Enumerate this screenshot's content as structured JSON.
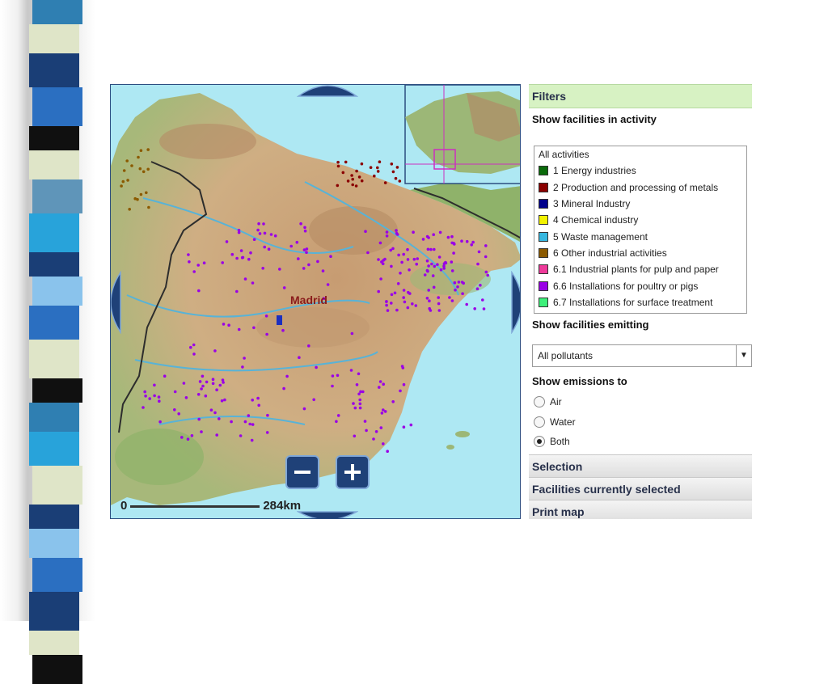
{
  "map": {
    "city_label": "Madrid",
    "scale_start": "0",
    "scale_end": "284km",
    "zoom_out_label": "−",
    "zoom_in_label": "+",
    "colors": {
      "sea": "#aee8f3",
      "land": "#cfa77c",
      "points": "#9a2be2"
    }
  },
  "filters": {
    "header": "Filters",
    "activity_heading": "Show facilities in activity",
    "activities": [
      {
        "label": "All activities",
        "color": ""
      },
      {
        "label": "1 Energy industries",
        "color": "#0a6a0a"
      },
      {
        "label": "2 Production and processing of metals",
        "color": "#8b0000"
      },
      {
        "label": "3 Mineral Industry",
        "color": "#00008b"
      },
      {
        "label": "4 Chemical industry",
        "color": "#f2f200"
      },
      {
        "label": "5 Waste management",
        "color": "#36b7e0"
      },
      {
        "label": "6 Other industrial activities",
        "color": "#8b5a00"
      },
      {
        "label": "6.1  Industrial plants for pulp and paper",
        "color": "#ee3a9a"
      },
      {
        "label": "6.6  Installations for poultry or pigs",
        "color": "#9a00e6"
      },
      {
        "label": "6.7  Installations for surface treatment",
        "color": "#3ef07a"
      }
    ],
    "emitting_heading": "Show facilities emitting",
    "pollutant_value": "All pollutants",
    "emissions_heading": "Show emissions to",
    "emission_options": [
      {
        "label": "Air",
        "selected": false
      },
      {
        "label": "Water",
        "selected": false
      },
      {
        "label": "Both",
        "selected": true
      }
    ]
  },
  "accordion": {
    "selection": "Selection",
    "selected_facilities": "Facilities currently selected",
    "print_map": "Print map"
  }
}
